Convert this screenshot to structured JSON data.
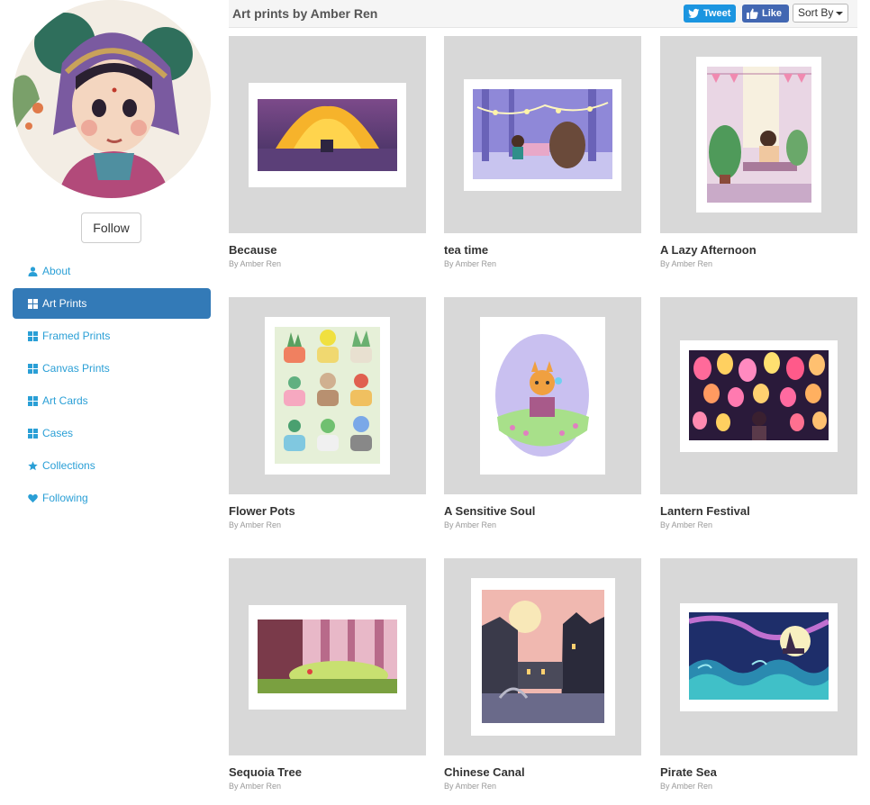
{
  "sidebar": {
    "follow_label": "Follow",
    "nav": [
      {
        "label": "About",
        "icon": "user-icon",
        "active": false
      },
      {
        "label": "Art Prints",
        "icon": "grid-icon",
        "active": true
      },
      {
        "label": "Framed Prints",
        "icon": "grid-icon",
        "active": false
      },
      {
        "label": "Canvas Prints",
        "icon": "grid-icon",
        "active": false
      },
      {
        "label": "Art Cards",
        "icon": "grid-icon",
        "active": false
      },
      {
        "label": "Cases",
        "icon": "grid-icon",
        "active": false
      },
      {
        "label": "Collections",
        "icon": "star-icon",
        "active": false
      },
      {
        "label": "Following",
        "icon": "heart-icon",
        "active": false
      }
    ]
  },
  "header": {
    "title": "Art prints by Amber Ren",
    "tweet_label": "Tweet",
    "like_label": "Like",
    "sort_label": "Sort By"
  },
  "colors": {
    "link": "#2a9fd6",
    "active_nav": "#337ab7",
    "twitter": "#1b95e0",
    "facebook": "#4267b2",
    "tile_bg": "#d8d8d8"
  },
  "prints": [
    {
      "title": "Because",
      "artist": "By Amber Ren"
    },
    {
      "title": "tea time",
      "artist": "By Amber Ren"
    },
    {
      "title": "A Lazy Afternoon",
      "artist": "By Amber Ren"
    },
    {
      "title": "Flower Pots",
      "artist": "By Amber Ren"
    },
    {
      "title": "A Sensitive Soul",
      "artist": "By Amber Ren"
    },
    {
      "title": "Lantern Festival",
      "artist": "By Amber Ren"
    },
    {
      "title": "Sequoia Tree",
      "artist": "By Amber Ren"
    },
    {
      "title": "Chinese Canal",
      "artist": "By Amber Ren"
    },
    {
      "title": "Pirate Sea",
      "artist": "By Amber Ren"
    }
  ]
}
